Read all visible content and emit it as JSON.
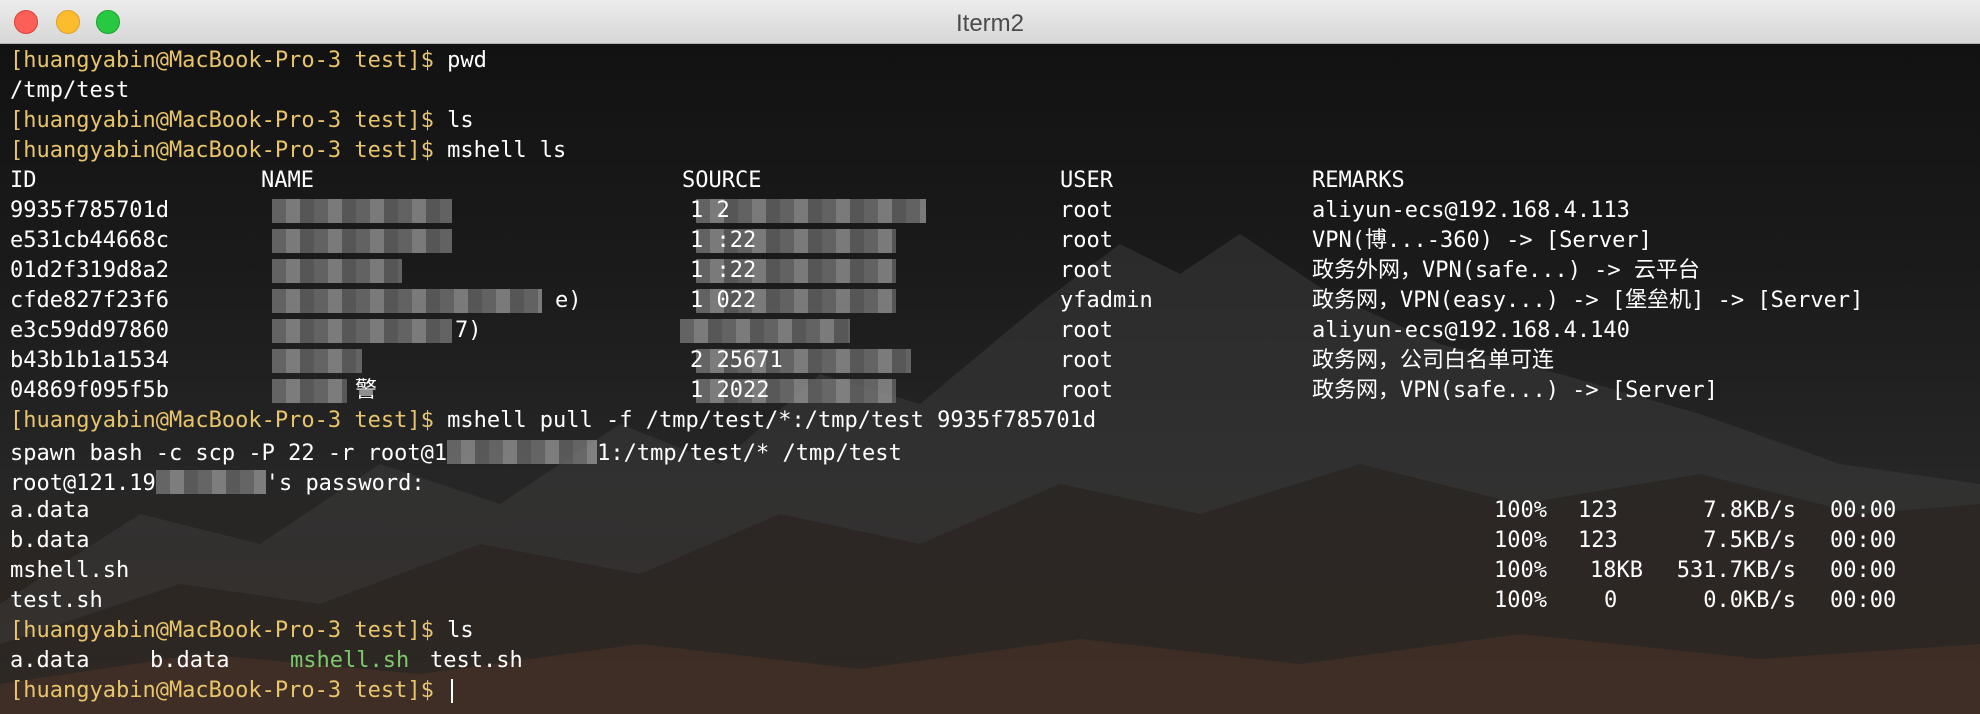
{
  "window": {
    "title": "Iterm2"
  },
  "prompt": "[huangyabin@MacBook-Pro-3 test]$",
  "session": {
    "l1_cmd": "pwd",
    "l2_out": "/tmp/test",
    "l3_cmd": "ls",
    "l4_cmd": "mshell ls",
    "table": {
      "headers": [
        "ID",
        "NAME",
        "SOURCE",
        "USER",
        "REMARKS"
      ],
      "rows": [
        {
          "id": "9935f785701d",
          "name": "",
          "source": "1 2",
          "user": "root",
          "remarks": "aliyun-ecs@192.168.4.113"
        },
        {
          "id": "e531cb44668c",
          "name": "",
          "source": "1 :22",
          "user": "root",
          "remarks": "VPN(博...-360) -> [Server]"
        },
        {
          "id": "01d2f319d8a2",
          "name": "",
          "source": "1 :22",
          "user": "root",
          "remarks": "政务外网，VPN(safe...) -> 云平台"
        },
        {
          "id": "cfde827f23f6",
          "name": "e)",
          "source": "1 022",
          "user": "yfadmin",
          "remarks": "政务网，VPN(easy...) -> [堡垒机] -> [Server]"
        },
        {
          "id": "e3c59dd97860",
          "name": "7)",
          "source": "",
          "user": "root",
          "remarks": "aliyun-ecs@192.168.4.140"
        },
        {
          "id": "b43b1b1a1534",
          "name": "",
          "source": "2 25671",
          "user": "root",
          "remarks": "政务网，公司白名单可连"
        },
        {
          "id": "04869f095f5b",
          "name": "警",
          "source": "1 2022",
          "user": "root",
          "remarks": "政务网，VPN(safe...) -> [Server]"
        }
      ]
    },
    "pull_cmd": "mshell pull -f /tmp/test/*:/tmp/test 9935f785701d",
    "spawn_a": "spawn bash -c scp -P 22 -r root@1",
    "spawn_b": "1:/tmp/test/* /tmp/test",
    "pwd_a": "root@121.19",
    "pwd_b": "'s password:",
    "transfers": [
      {
        "file": "a.data",
        "pct": "100%",
        "size": "123",
        "rate": "7.8KB/s",
        "time": "00:00"
      },
      {
        "file": "b.data",
        "pct": "100%",
        "size": "123",
        "rate": "7.5KB/s",
        "time": "00:00"
      },
      {
        "file": "mshell.sh",
        "pct": "100%",
        "size": "18KB",
        "rate": "531.7KB/s",
        "time": "00:00"
      },
      {
        "file": "test.sh",
        "pct": "100%",
        "size": "0",
        "rate": "0.0KB/s",
        "time": "00:00"
      }
    ],
    "ls2_cmd": "ls",
    "ls_files": [
      "a.data",
      "b.data",
      "mshell.sh",
      "test.sh"
    ]
  },
  "colors": {
    "prompt": "#e8c46a",
    "exec_file": "#7ec96b",
    "text": "#ffffff"
  }
}
